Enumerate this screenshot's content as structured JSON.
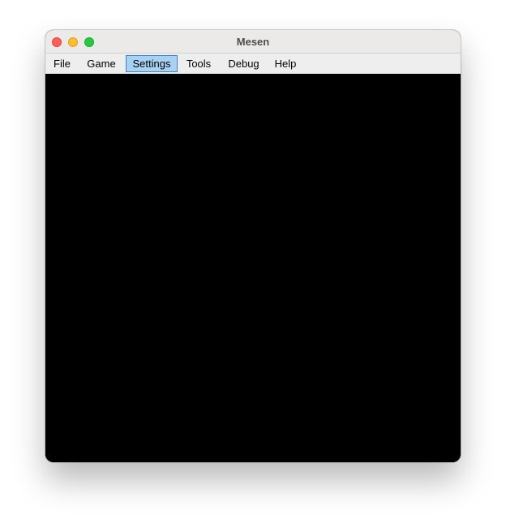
{
  "window": {
    "title": "Mesen"
  },
  "menu": {
    "items": [
      {
        "label": "File"
      },
      {
        "label": "Game"
      },
      {
        "label": "Settings",
        "active": true
      },
      {
        "label": "Tools"
      },
      {
        "label": "Debug"
      },
      {
        "label": "Help"
      }
    ]
  },
  "colors": {
    "close": "#fe5f57",
    "minimize": "#febc2e",
    "zoom": "#28c840",
    "menu_highlight": "#a8d1f3",
    "menu_highlight_border": "#3d84c2",
    "content_background": "#000000"
  }
}
